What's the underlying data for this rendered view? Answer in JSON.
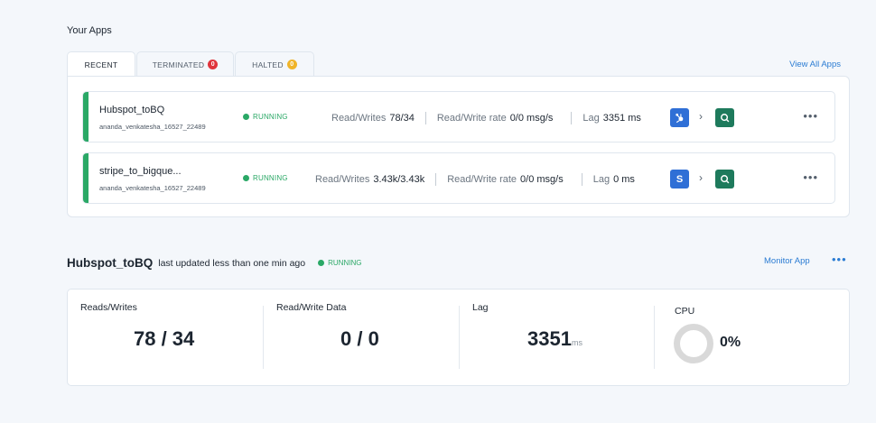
{
  "section_title": "Your Apps",
  "tabs": [
    {
      "label": "RECENT",
      "badge": null,
      "active": true
    },
    {
      "label": "TERMINATED",
      "badge": "0",
      "badge_color": "#e0343c",
      "active": false
    },
    {
      "label": "HALTED",
      "badge": "0",
      "badge_color": "#f0b429",
      "active": false
    }
  ],
  "view_all_label": "View All Apps",
  "apps": [
    {
      "name": "Hubspot_toBQ",
      "owner": "ananda_venkatesha_16527_22489",
      "status": "RUNNING",
      "rw_label": "Read/Writes",
      "rw_value": "78/34",
      "rate_label": "Read/Write rate",
      "rate_value": "0/0 msg/s",
      "lag_label": "Lag",
      "lag_value": "3351 ms",
      "source_icon": "hubspot-icon",
      "dest_icon": "bigquery-icon"
    },
    {
      "name": "stripe_to_bigque...",
      "owner": "ananda_venkatesha_16527_22489",
      "status": "RUNNING",
      "rw_label": "Read/Writes",
      "rw_value": "3.43k/3.43k",
      "rate_label": "Read/Write rate",
      "rate_value": "0/0 msg/s",
      "lag_label": "Lag",
      "lag_value": "0 ms",
      "source_icon": "stripe-icon",
      "source_glyph": "S",
      "dest_icon": "bigquery-icon"
    }
  ],
  "detail": {
    "title": "Hubspot_toBQ",
    "subtitle": "last updated less than one min ago",
    "status": "RUNNING",
    "monitor_label": "Monitor App",
    "stats": {
      "rw_label": "Reads/Writes",
      "rw_value": "78 / 34",
      "data_label": "Read/Write Data",
      "data_value": "0 / 0",
      "lag_label": "Lag",
      "lag_value": "3351",
      "lag_unit": "ms",
      "cpu_label": "CPU",
      "cpu_value": "0%",
      "cpu_fraction": 0
    }
  },
  "colors": {
    "accent": "#2b7cd3",
    "running": "#2aa866",
    "background": "#f4f7fb"
  }
}
